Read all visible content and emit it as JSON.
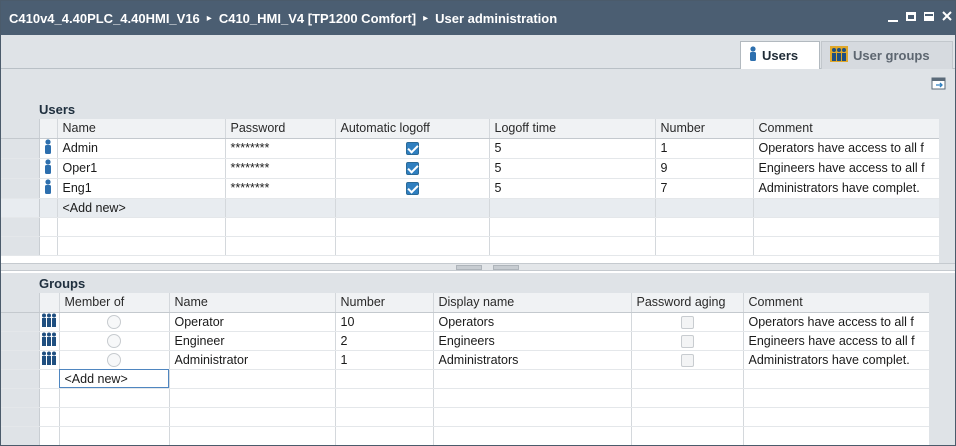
{
  "titlebar": {
    "crumbs": [
      "C410v4_4.40PLC_4.40HMI_V16",
      "C410_HMI_V4 [TP1200 Comfort]",
      "User administration"
    ],
    "separator": "▸"
  },
  "tabs": {
    "users": "Users",
    "user_groups": "User groups"
  },
  "users_section": {
    "title": "Users",
    "columns": [
      "Name",
      "Password",
      "Automatic logoff",
      "Logoff time",
      "Number",
      "Comment"
    ],
    "rows": [
      {
        "name": "Admin",
        "password": "********",
        "auto_logoff": true,
        "logoff_time": "5",
        "number": "1",
        "comment": "Operators have access to all f"
      },
      {
        "name": "Oper1",
        "password": "********",
        "auto_logoff": true,
        "logoff_time": "5",
        "number": "9",
        "comment": "Engineers have access to all f"
      },
      {
        "name": "Eng1",
        "password": "********",
        "auto_logoff": true,
        "logoff_time": "5",
        "number": "7",
        "comment": "Administrators have complet."
      }
    ],
    "add_new": "<Add new>"
  },
  "groups_section": {
    "title": "Groups",
    "columns": [
      "Member of",
      "Name",
      "Number",
      "Display name",
      "Password aging",
      "Comment"
    ],
    "rows": [
      {
        "member_of": false,
        "name": "Operator",
        "number": "10",
        "display_name": "Operators",
        "password_aging": false,
        "comment": "Operators have access to all f"
      },
      {
        "member_of": false,
        "name": "Engineer",
        "number": "2",
        "display_name": "Engineers",
        "password_aging": false,
        "comment": "Engineers have access to all f"
      },
      {
        "member_of": false,
        "name": "Administrator",
        "number": "1",
        "display_name": "Administrators",
        "password_aging": false,
        "comment": "Administrators have complet."
      }
    ],
    "add_new": "<Add new>"
  },
  "icons": {
    "user": "user-icon",
    "group": "group-icon",
    "export": "export-icon"
  },
  "colors": {
    "titlebar": "#4b5e72",
    "panel": "#dfe3e7",
    "checkbox": "#2f7fc0",
    "user_icon": "#2d6fae"
  }
}
